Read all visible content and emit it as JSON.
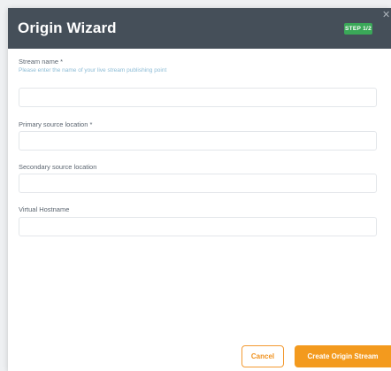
{
  "dialog": {
    "title": "Origin Wizard",
    "step_badge": "STEP 1/2",
    "close_icon": "close-icon"
  },
  "form": {
    "stream_name": {
      "label": "Stream name *",
      "help": "Please enter the name of your live stream publishing point",
      "value": ""
    },
    "primary_source": {
      "label": "Primary source location *",
      "value": ""
    },
    "secondary_source": {
      "label": "Secondary source location",
      "value": ""
    },
    "virtual_hostname": {
      "label": "Virtual Hostname",
      "value": ""
    }
  },
  "actions": {
    "cancel_label": "Cancel",
    "create_label": "Create Origin Stream"
  },
  "colors": {
    "header_bg": "#454f59",
    "badge_green": "#3aa858",
    "accent_orange": "#f39a1e",
    "help_text_blue": "#8dbcd6"
  }
}
